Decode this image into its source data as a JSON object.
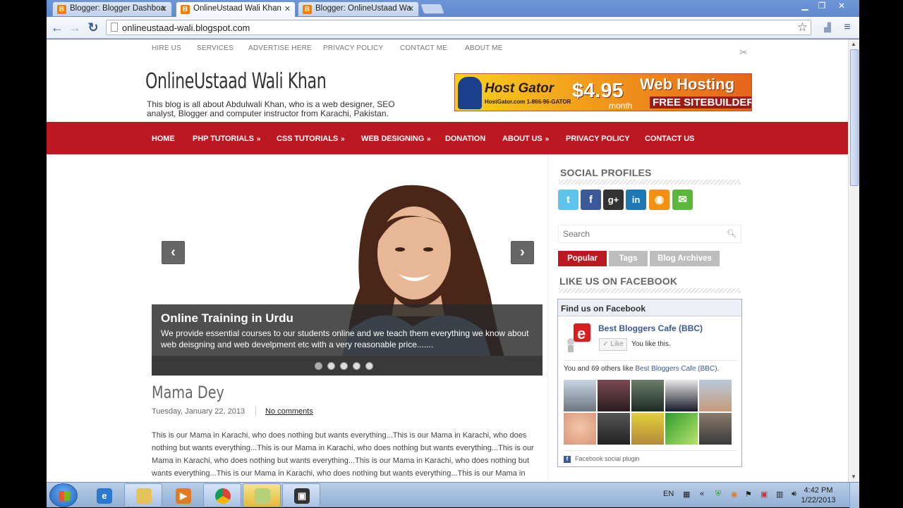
{
  "browser": {
    "tabs": [
      {
        "label": "Blogger: Blogger Dashboa",
        "active": false
      },
      {
        "label": "OnlineUstaad Wali Khan",
        "active": true
      },
      {
        "label": "Blogger: OnlineUstaad Wa",
        "active": false
      }
    ],
    "url": "onlineustaad-wali.blogspot.com",
    "icons": {
      "back": "back-arrow-icon",
      "forward": "forward-arrow-icon",
      "reload": "reload-icon",
      "star": "bookmark-star-icon",
      "menu": "menu-icon"
    }
  },
  "site": {
    "top_nav": [
      "HIRE US",
      "SERVICES",
      "ADVERTISE HERE",
      "PRIVACY POLICY",
      "CONTACT ME",
      "ABOUT ME"
    ],
    "title": "OnlineUstaad Wali Khan",
    "description": "This blog is all about Abdulwali Khan, who is a web designer, SEO analyst, Blogger and computer instructor from Karachi, Pakistan.",
    "banner": {
      "brand": "Host Gator",
      "phone": "HostGator.com 1-866-96-GATOR",
      "price": "$4.95",
      "period": "month",
      "headline": "Web Hosting",
      "sub": "FREE SITEBUILDER"
    },
    "main_nav": [
      {
        "label": "HOME",
        "has_sub": false
      },
      {
        "label": "PHP TUTORIALS",
        "has_sub": true
      },
      {
        "label": "CSS TUTORIALS",
        "has_sub": true
      },
      {
        "label": "WEB DESIGNING",
        "has_sub": true
      },
      {
        "label": "DONATION",
        "has_sub": false
      },
      {
        "label": "ABOUT US",
        "has_sub": true
      },
      {
        "label": "PRIVACY POLICY",
        "has_sub": false
      },
      {
        "label": "CONTACT US",
        "has_sub": false
      }
    ],
    "submenu_marker": "»",
    "accent_color": "#bb1822"
  },
  "slider": {
    "prev": "‹",
    "next": "›",
    "caption_title": "Online Training in Urdu",
    "caption_text": "We provide essential courses to our students online and we teach them everything we know about web deisgning and web develpment etc with a very reasonable price.......",
    "slide_count": 5,
    "active_slide": 1
  },
  "post": {
    "title": "Mama Dey",
    "date": "Tuesday, January 22, 2013",
    "comments": "No comments",
    "body": "This is our Mama in Karachi, who does nothing but wants everything...This is our Mama in Karachi, who does nothing but wants everything...This is our Mama in Karachi, who does nothing but wants everything...This is our Mama in Karachi, who does nothing but wants everything...This is our Mama in Karachi, who does nothing but wants everything...This is our Mama in Karachi, who does nothing but wants everything...This is our Mama in"
  },
  "sidebar": {
    "social_title": "SOCIAL PROFILES",
    "social_icons": [
      {
        "name": "twitter-icon",
        "glyph": "t",
        "color": "#5ec4ec"
      },
      {
        "name": "facebook-icon",
        "glyph": "f",
        "color": "#3b5998"
      },
      {
        "name": "google-plus-icon",
        "glyph": "g+",
        "color": "#333333"
      },
      {
        "name": "linkedin-icon",
        "glyph": "in",
        "color": "#1f78b4"
      },
      {
        "name": "rss-icon",
        "glyph": "◉",
        "color": "#f29111"
      },
      {
        "name": "email-icon",
        "glyph": "✉",
        "color": "#5cb83d"
      }
    ],
    "search_placeholder": "Search",
    "tabs": [
      {
        "label": "Popular",
        "active": true
      },
      {
        "label": "Tags",
        "active": false
      },
      {
        "label": "Blog Archives",
        "active": false
      }
    ],
    "facebook_title": "LIKE US ON FACEBOOK",
    "fb_box": {
      "header": "Find us on Facebook",
      "page_name": "Best Bloggers Cafe (BBC)",
      "like_button": "Like",
      "liked_text": "You like this.",
      "others_prefix": "You and 69 others like ",
      "others_page": "Best Bloggers Cafe (BBC)",
      "others_suffix": ".",
      "footer": "Facebook social plugin"
    }
  },
  "taskbar": {
    "language": "EN",
    "time": "4:42 PM",
    "date": "1/22/2013",
    "apps": [
      "internet-explorer-icon",
      "file-explorer-icon",
      "media-player-icon",
      "chrome-icon",
      "notes-icon",
      "camera-app-icon"
    ]
  }
}
